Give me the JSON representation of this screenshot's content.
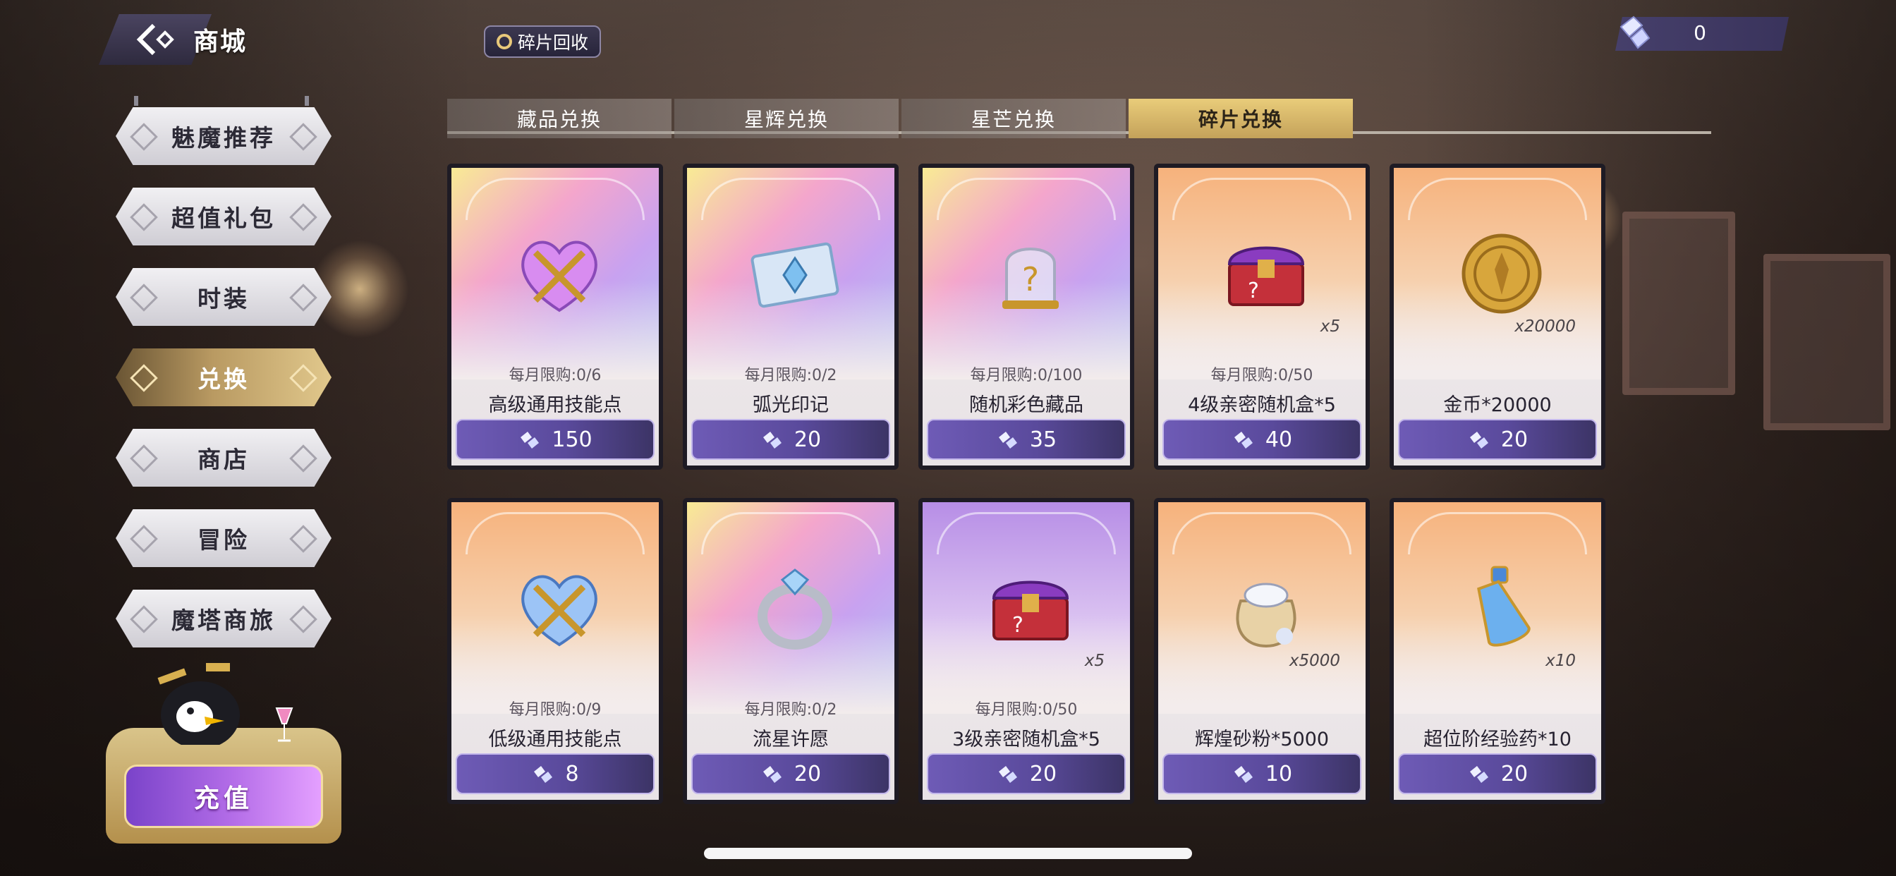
{
  "header": {
    "title": "商城",
    "recycle_label": "碎片回收",
    "currency_value": "0"
  },
  "sidebar": {
    "items": [
      {
        "label": "魅魔推荐",
        "active": false
      },
      {
        "label": "超值礼包",
        "active": false
      },
      {
        "label": "时装",
        "active": false
      },
      {
        "label": "兑换",
        "active": true
      },
      {
        "label": "商店",
        "active": false
      },
      {
        "label": "冒险",
        "active": false
      },
      {
        "label": "魔塔商旅",
        "active": false
      }
    ],
    "recharge_label": "充值"
  },
  "tabs": [
    {
      "label": "藏品兑换",
      "active": false
    },
    {
      "label": "星辉兑换",
      "active": false
    },
    {
      "label": "星芒兑换",
      "active": false
    },
    {
      "label": "碎片兑换",
      "active": true
    }
  ],
  "items": [
    {
      "name": "高级通用技能点",
      "limit": "每月限购:0/6",
      "qty": "",
      "price": "150",
      "icon": "heart-cross-icon",
      "theme": "rainbow"
    },
    {
      "name": "弧光印记",
      "limit": "每月限购:0/2",
      "qty": "",
      "price": "20",
      "icon": "ticket-crystal-icon",
      "theme": "rainbow"
    },
    {
      "name": "随机彩色藏品",
      "limit": "每月限购:0/100",
      "qty": "",
      "price": "35",
      "icon": "mystery-bell-jar-icon",
      "theme": "rainbow"
    },
    {
      "name": "4级亲密随机盒*5",
      "limit": "每月限购:0/50",
      "qty": "x5",
      "price": "40",
      "icon": "mystery-chest-icon",
      "theme": "orange"
    },
    {
      "name": "金币*20000",
      "limit": "",
      "qty": "x20000",
      "price": "20",
      "icon": "gold-coin-icon",
      "theme": "orange"
    },
    {
      "name": "低级通用技能点",
      "limit": "每月限购:0/9",
      "qty": "",
      "price": "8",
      "icon": "heart-cross-blue-icon",
      "theme": "orange"
    },
    {
      "name": "流星许愿",
      "limit": "每月限购:0/2",
      "qty": "",
      "price": "20",
      "icon": "crystal-ring-icon",
      "theme": "rainbow"
    },
    {
      "name": "3级亲密随机盒*5",
      "limit": "每月限购:0/50",
      "qty": "x5",
      "price": "20",
      "icon": "mystery-chest-icon",
      "theme": "purple"
    },
    {
      "name": "辉煌砂粉*5000",
      "limit": "",
      "qty": "x5000",
      "price": "10",
      "icon": "sand-pouch-icon",
      "theme": "orange"
    },
    {
      "name": "超位阶经验药*10",
      "limit": "",
      "qty": "x10",
      "price": "20",
      "icon": "potion-bottle-icon",
      "theme": "orange"
    }
  ],
  "colors": {
    "accent_gold": "#e9cc7a",
    "price_purple": "#6e5bb6",
    "recharge_purple": "#b46de8"
  }
}
